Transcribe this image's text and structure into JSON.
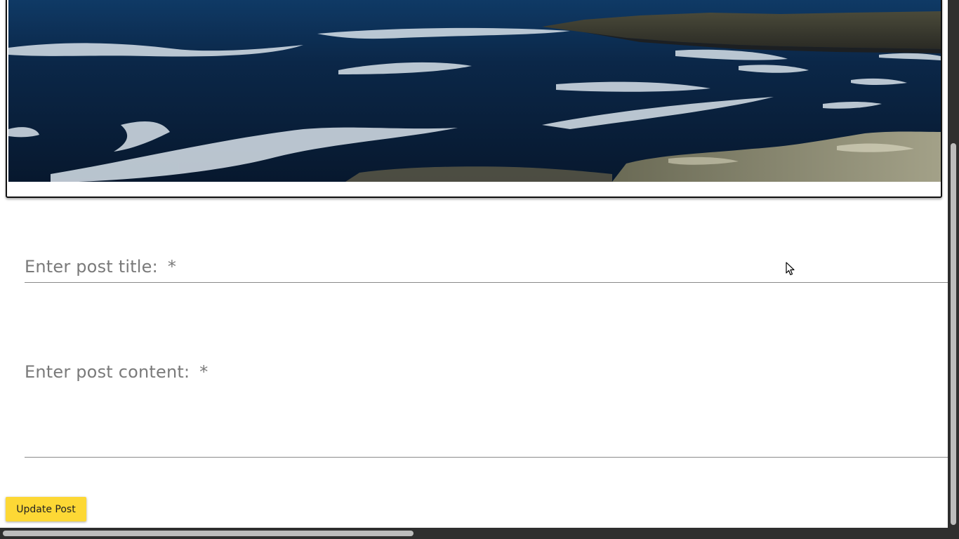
{
  "hero": {
    "image_name": "coastal-sea-cliffs-photo"
  },
  "form": {
    "title_label": "Enter post title:",
    "title_required_mark": "*",
    "title_value": "",
    "content_label": "Enter post content:",
    "content_required_mark": "*",
    "content_value": ""
  },
  "actions": {
    "update_label": "Update Post"
  },
  "colors": {
    "button_accent": "#fdd835",
    "label_text": "#7a7a7a",
    "field_underline": "#8a8a8a"
  },
  "icons": {
    "cursor": "mouse-pointer-icon"
  }
}
